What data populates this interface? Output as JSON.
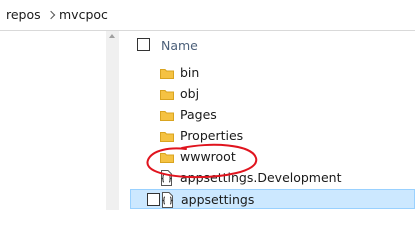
{
  "breadcrumb": {
    "items": [
      "repos",
      "mvcpoc"
    ]
  },
  "columns": {
    "name_label": "Name"
  },
  "files": [
    {
      "label": "bin",
      "type": "folder"
    },
    {
      "label": "obj",
      "type": "folder"
    },
    {
      "label": "Pages",
      "type": "folder"
    },
    {
      "label": "Properties",
      "type": "folder"
    },
    {
      "label": "wwwroot",
      "type": "folder"
    },
    {
      "label": "appsettings.Development",
      "type": "json-file"
    },
    {
      "label": "appsettings",
      "type": "json-file"
    }
  ],
  "selected_item": "appsettings",
  "annotation": {
    "color": "#e0141e",
    "shape": "hand-drawn-circle"
  },
  "colors": {
    "folder": "#f5c242",
    "selection_bg": "#cce8ff",
    "selection_border": "#99d1ff",
    "header_text": "#4c607a"
  }
}
